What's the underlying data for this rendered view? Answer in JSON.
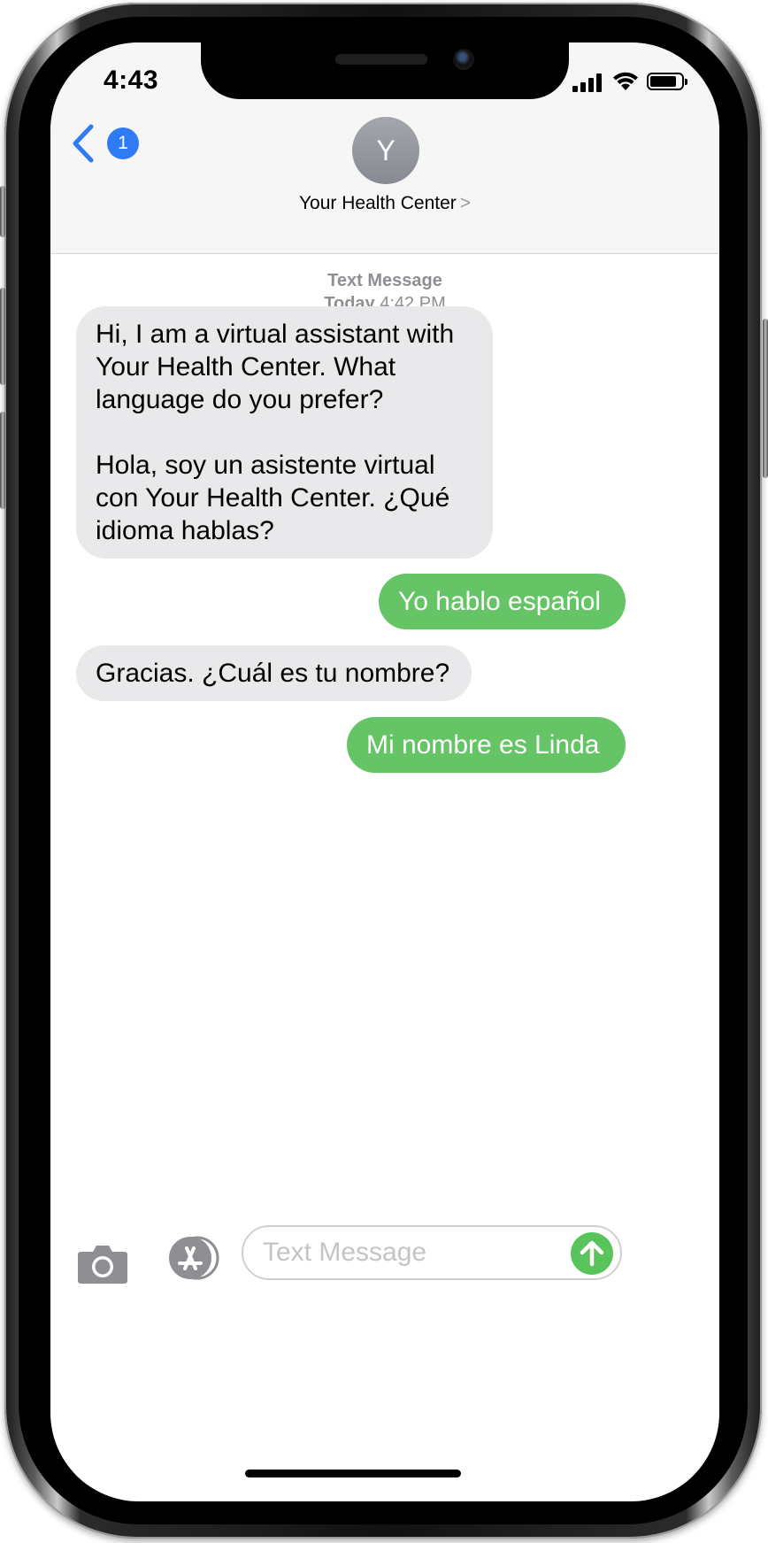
{
  "status_bar": {
    "time": "4:43",
    "signal_bars": 4,
    "battery_level": 0.85
  },
  "nav": {
    "back_badge": "1",
    "contact_initial": "Y",
    "contact_name": "Your Health Center",
    "contact_chevron": ">"
  },
  "conversation": {
    "service_label": "Text Message",
    "day_label": "Today",
    "time_label": "4:42 PM",
    "messages": [
      {
        "direction": "incoming",
        "lines": [
          "Hi, I am a virtual assistant with",
          "Your Health Center. What",
          "language do you prefer?",
          "",
          "Hola, soy un asistente virtual",
          "con Your Health Center. ¿Qué",
          "idioma hablas?"
        ]
      },
      {
        "direction": "outgoing",
        "lines": [
          "Yo hablo español"
        ]
      },
      {
        "direction": "incoming",
        "lines": [
          "Gracias. ¿Cuál es tu nombre?"
        ]
      },
      {
        "direction": "outgoing",
        "lines": [
          "Mi nombre es Linda"
        ]
      }
    ]
  },
  "composer": {
    "placeholder": "Text Message",
    "value": ""
  },
  "colors": {
    "incoming_bubble": "#e9e9eb",
    "outgoing_bubble": "#65c466",
    "accent_blue": "#2f7bf5",
    "send_button": "#5ac45c"
  },
  "icons": {
    "back": "chevron-left-icon",
    "camera": "camera-icon",
    "app_store": "app-store-icon",
    "send": "arrow-up-icon",
    "signal": "cellular-signal-icon",
    "wifi": "wifi-icon",
    "battery": "battery-icon"
  }
}
